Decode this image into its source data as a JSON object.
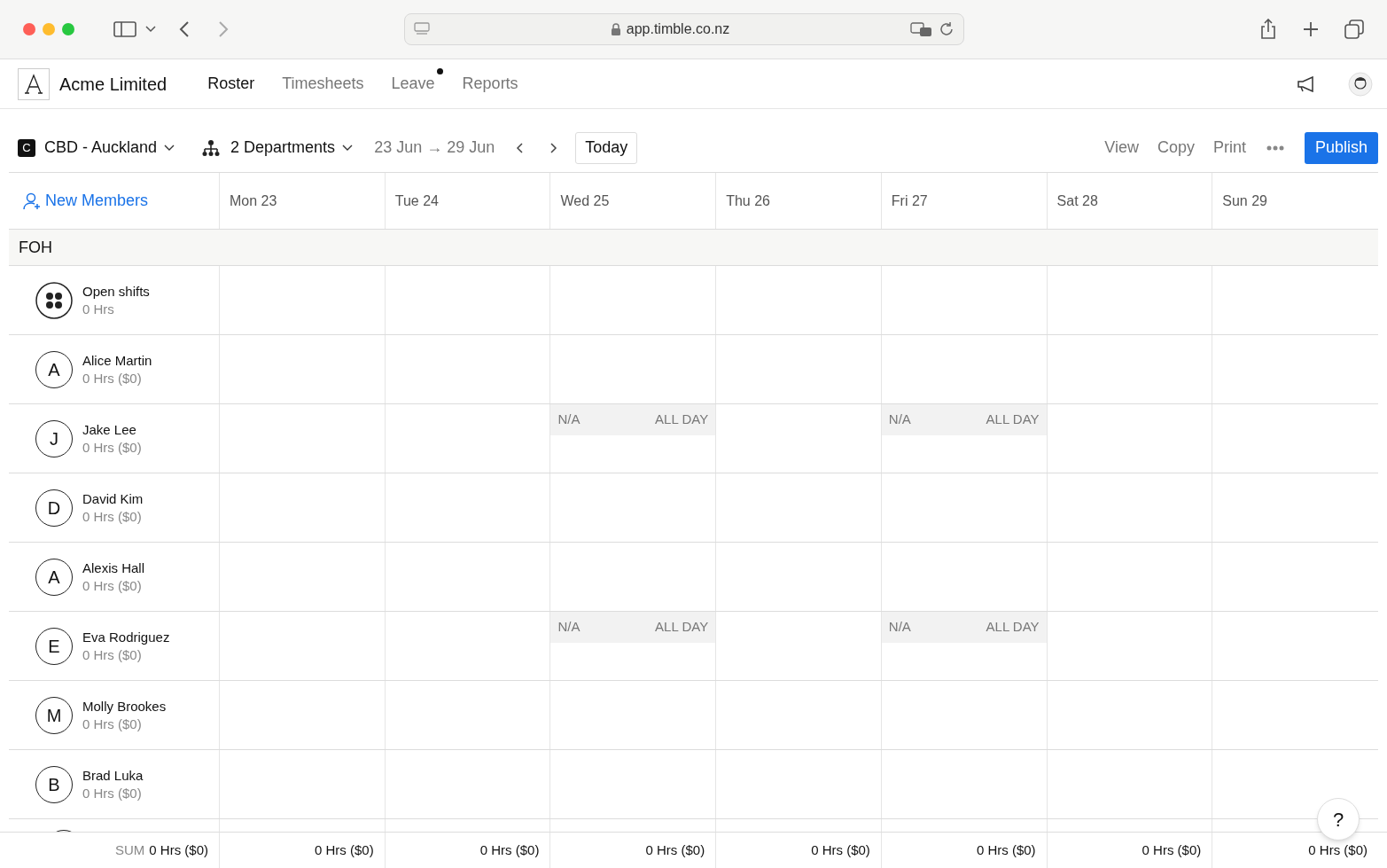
{
  "browser": {
    "url": "app.timble.co.nz"
  },
  "app": {
    "company": "Acme Limited",
    "nav": [
      {
        "label": "Roster",
        "selected": true,
        "badge": false
      },
      {
        "label": "Timesheets",
        "selected": false,
        "badge": false
      },
      {
        "label": "Leave",
        "selected": false,
        "badge": true
      },
      {
        "label": "Reports",
        "selected": false,
        "badge": false
      }
    ]
  },
  "toolbar": {
    "location_initial": "C",
    "location": "CBD - Auckland",
    "departments": "2 Departments",
    "date_range": "23 Jun → 29 Jun",
    "today": "Today",
    "actions": [
      "View",
      "Copy",
      "Print"
    ],
    "publish": "Publish"
  },
  "roster": {
    "new_members": "New Members",
    "days": [
      "Mon 23",
      "Tue 24",
      "Wed 25",
      "Thu 26",
      "Fri 27",
      "Sat 28",
      "Sun 29"
    ],
    "group": "FOH",
    "rows": [
      {
        "kind": "open",
        "name": "Open shifts",
        "hours": "0 Hrs",
        "cells": [
          null,
          null,
          null,
          null,
          null,
          null,
          null
        ]
      },
      {
        "kind": "member",
        "initial": "A",
        "name": "Alice Martin",
        "hours": "0 Hrs ($0)",
        "cells": [
          null,
          null,
          null,
          null,
          null,
          null,
          null
        ]
      },
      {
        "kind": "member",
        "initial": "J",
        "name": "Jake Lee",
        "hours": "0 Hrs ($0)",
        "cells": [
          null,
          null,
          {
            "status": "N/A",
            "time": "ALL DAY"
          },
          null,
          {
            "status": "N/A",
            "time": "ALL DAY"
          },
          null,
          null
        ]
      },
      {
        "kind": "member",
        "initial": "D",
        "name": "David Kim",
        "hours": "0 Hrs ($0)",
        "cells": [
          null,
          null,
          null,
          null,
          null,
          null,
          null
        ]
      },
      {
        "kind": "member",
        "initial": "A",
        "name": "Alexis Hall",
        "hours": "0 Hrs ($0)",
        "cells": [
          null,
          null,
          null,
          null,
          null,
          null,
          null
        ]
      },
      {
        "kind": "member",
        "initial": "E",
        "name": "Eva Rodriguez",
        "hours": "0 Hrs ($0)",
        "cells": [
          null,
          null,
          {
            "status": "N/A",
            "time": "ALL DAY"
          },
          null,
          {
            "status": "N/A",
            "time": "ALL DAY"
          },
          null,
          null
        ]
      },
      {
        "kind": "member",
        "initial": "M",
        "name": "Molly Brookes",
        "hours": "0 Hrs ($0)",
        "cells": [
          null,
          null,
          null,
          null,
          null,
          null,
          null
        ]
      },
      {
        "kind": "member",
        "initial": "B",
        "name": "Brad Luka",
        "hours": "0 Hrs ($0)",
        "cells": [
          null,
          null,
          null,
          null,
          null,
          null,
          null
        ]
      }
    ],
    "footer": {
      "label": "SUM",
      "total": "0 Hrs ($0)",
      "days": [
        "0 Hrs ($0)",
        "0 Hrs ($0)",
        "0 Hrs ($0)",
        "0 Hrs ($0)",
        "0 Hrs ($0)",
        "0 Hrs ($0)",
        "0 Hrs ($0)"
      ]
    }
  },
  "help": "?"
}
